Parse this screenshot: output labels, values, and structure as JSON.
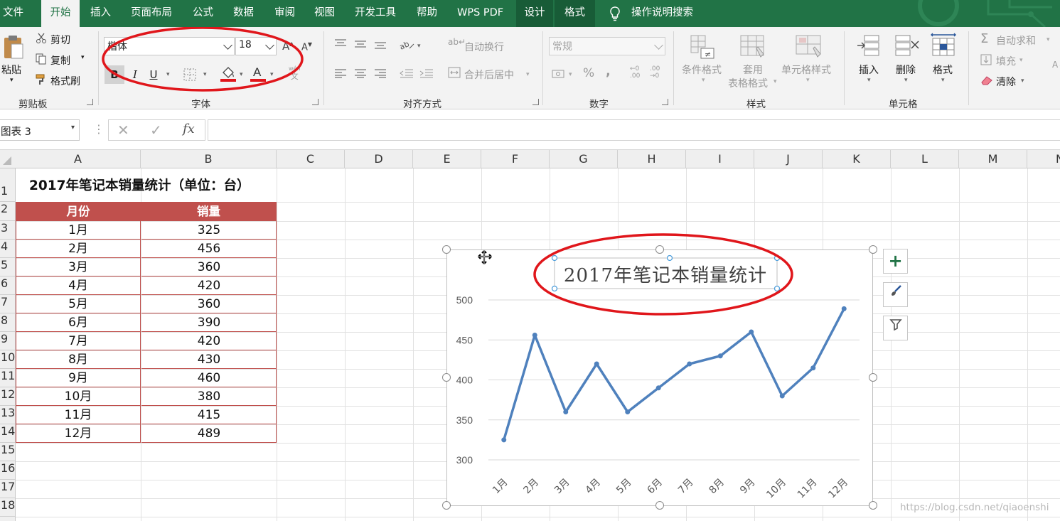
{
  "tabs": [
    "文件",
    "开始",
    "插入",
    "页面布局",
    "公式",
    "数据",
    "审阅",
    "视图",
    "开发工具",
    "帮助",
    "WPS PDF",
    "设计",
    "格式",
    "操作说明搜索"
  ],
  "clipboard": {
    "paste": "粘贴",
    "cut": "剪切",
    "copy": "复制",
    "format_painter": "格式刷",
    "group": "剪贴板"
  },
  "font": {
    "name": "楷体",
    "size": "18",
    "bold": "B",
    "italic": "I",
    "underline": "U",
    "group": "字体",
    "wen": "wén",
    "wen_char": "文"
  },
  "alignment": {
    "wrap": "自动换行",
    "merge": "合并后居中",
    "group": "对齐方式"
  },
  "number": {
    "format": "常规",
    "percent": "%",
    "comma": ",",
    "inc": "←0\n.00",
    "dec": ".00\n→0",
    "group": "数字"
  },
  "styles": {
    "conditional": "条件格式",
    "table1": "套用",
    "table2": "表格格式",
    "cell_style": "单元格样式",
    "group": "样式"
  },
  "cells": {
    "insert": "插入",
    "delete": "删除",
    "format": "格式",
    "group": "单元格"
  },
  "editing": {
    "autosum": "自动求和",
    "fill": "填充",
    "clear": "清除"
  },
  "namebox": "图表 3",
  "fx": "fx",
  "columns": [
    "A",
    "B",
    "C",
    "D",
    "E",
    "F",
    "G",
    "H",
    "I",
    "J",
    "K",
    "L",
    "M",
    "N"
  ],
  "rows": [
    "1",
    "2",
    "3",
    "4",
    "5",
    "6",
    "7",
    "8",
    "9",
    "10",
    "11",
    "12",
    "13",
    "14",
    "15",
    "16",
    "17",
    "18"
  ],
  "sheet": {
    "title": "2017年笔记本销量统计（单位：台）",
    "headers": [
      "月份",
      "销量"
    ],
    "data": [
      [
        "1月",
        "325"
      ],
      [
        "2月",
        "456"
      ],
      [
        "3月",
        "360"
      ],
      [
        "4月",
        "420"
      ],
      [
        "5月",
        "360"
      ],
      [
        "6月",
        "390"
      ],
      [
        "7月",
        "420"
      ],
      [
        "8月",
        "430"
      ],
      [
        "9月",
        "460"
      ],
      [
        "10月",
        "380"
      ],
      [
        "11月",
        "415"
      ],
      [
        "12月",
        "489"
      ]
    ]
  },
  "chart_data": {
    "type": "line",
    "title": "2017年笔记本销量统计",
    "categories": [
      "1月",
      "2月",
      "3月",
      "4月",
      "5月",
      "6月",
      "7月",
      "8月",
      "9月",
      "10月",
      "11月",
      "12月"
    ],
    "values": [
      325,
      456,
      360,
      420,
      360,
      390,
      420,
      430,
      460,
      380,
      415,
      489
    ],
    "yticks": [
      300,
      350,
      400,
      450,
      500
    ],
    "ylim": [
      300,
      500
    ],
    "color": "#4f81bd",
    "grid": true
  },
  "chart_side": {
    "add": "+",
    "filter": "⛛"
  },
  "watermark": "https://blog.csdn.net/qiaoenshi",
  "colors": {
    "excel_green": "#217346",
    "header_red": "#c0504d",
    "annot_red": "#e0161b"
  }
}
